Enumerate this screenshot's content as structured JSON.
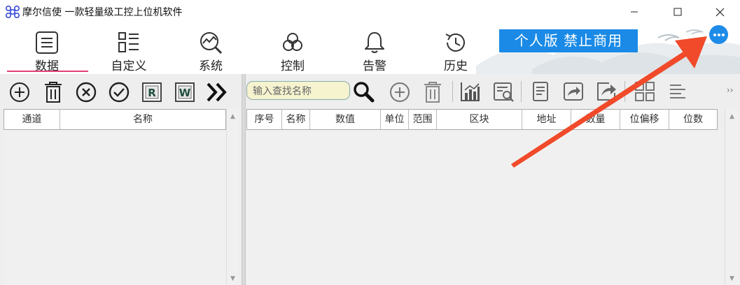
{
  "window": {
    "title": "摩尔信使  一款轻量级工控上位机软件"
  },
  "nav": {
    "items": [
      {
        "label": "数据",
        "icon": "list-icon"
      },
      {
        "label": "自定义",
        "icon": "grid-list-icon"
      },
      {
        "label": "系统",
        "icon": "chart-search-icon"
      },
      {
        "label": "控制",
        "icon": "knot-icon"
      },
      {
        "label": "告警",
        "icon": "bell-icon"
      },
      {
        "label": "历史",
        "icon": "history-icon"
      }
    ],
    "active_index": 0
  },
  "badge": {
    "text": "个人版  禁止商用"
  },
  "search": {
    "placeholder": "输入查找名称",
    "value": ""
  },
  "left_table": {
    "columns": [
      "通道",
      "名称"
    ]
  },
  "right_table": {
    "columns": [
      "序号",
      "名称",
      "数值",
      "单位",
      "范围",
      "区块",
      "地址",
      "数量",
      "位偏移",
      "位数"
    ]
  },
  "left_toolbar": {
    "icons": [
      "add-icon",
      "delete-icon",
      "remove-icon",
      "check-icon",
      "r-file-icon",
      "w-file-icon",
      "expand-icon"
    ]
  },
  "right_toolbar": {
    "icons": [
      "search-icon",
      "add-icon",
      "delete-icon",
      "bar-chart-icon",
      "report-search-icon",
      "document-icon",
      "import-icon",
      "share-icon",
      "tiles-icon",
      "align-left-icon",
      "more-right-icon"
    ]
  },
  "colors": {
    "accent_pink": "#e0407a",
    "badge_blue": "#1a8ae6",
    "panel_bg": "#eeeeee",
    "search_bg": "#f6f3cf",
    "annotation_arrow": "#f04a2a"
  }
}
